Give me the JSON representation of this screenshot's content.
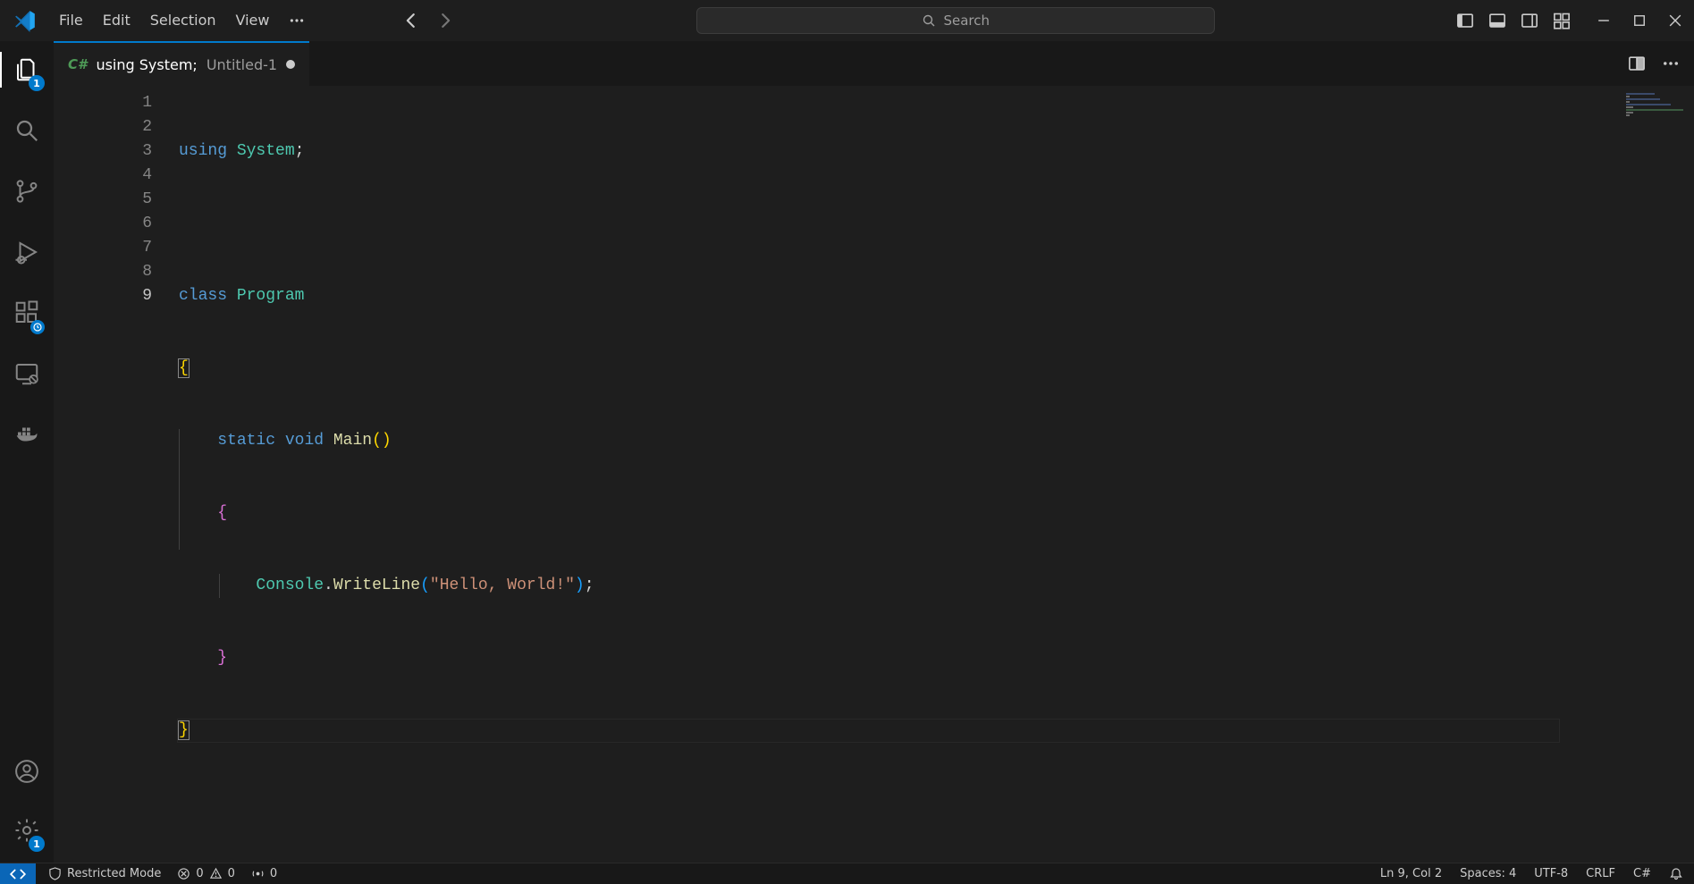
{
  "menu": {
    "file": "File",
    "edit": "Edit",
    "selection": "Selection",
    "view": "View"
  },
  "search": {
    "placeholder": "Search"
  },
  "activity": {
    "explorer_badge": "1",
    "gear_badge": "1"
  },
  "tab": {
    "title": "using System;",
    "subtitle": "Untitled-1",
    "lang_icon": "C#"
  },
  "code": {
    "lines": [
      "1",
      "2",
      "3",
      "4",
      "5",
      "6",
      "7",
      "8",
      "9"
    ],
    "tok": {
      "using": "using",
      "system": "System",
      "semi": ";",
      "class": "class",
      "program": "Program",
      "lbrace": "{",
      "rbrace": "}",
      "static": "static",
      "void": "void",
      "main": "Main",
      "lparen": "(",
      "rparen": ")",
      "console": "Console",
      "dot": ".",
      "writeline": "WriteLine",
      "str": "\"Hello, World!\""
    }
  },
  "status": {
    "restricted": "Restricted Mode",
    "err": "0",
    "warn": "0",
    "ports": "0",
    "cursor": "Ln 9, Col 2",
    "spaces": "Spaces: 4",
    "encoding": "UTF-8",
    "eol": "CRLF",
    "lang": "C#"
  }
}
